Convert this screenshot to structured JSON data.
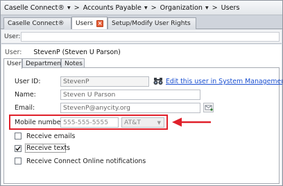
{
  "breadcrumb": {
    "items": [
      {
        "label": "Caselle Connect®",
        "dropdown": true
      },
      {
        "label": "Accounts Payable",
        "dropdown": true
      },
      {
        "label": "Organization",
        "dropdown": true
      },
      {
        "label": "Users",
        "dropdown": false
      }
    ],
    "separator": ">"
  },
  "tabs": [
    {
      "label": "Caselle Connect®",
      "active": false,
      "closable": false
    },
    {
      "label": "Users",
      "active": true,
      "closable": true
    },
    {
      "label": "Setup/Modify User Rights",
      "active": false,
      "closable": false
    }
  ],
  "search": {
    "label": "User:",
    "value": ""
  },
  "user_header": {
    "label": "User:",
    "value": "StevenP  (Steven U Parson)"
  },
  "inner_tabs": [
    {
      "label": "User",
      "active": true
    },
    {
      "label": "Departments",
      "active": false
    },
    {
      "label": "Notes",
      "active": false
    }
  ],
  "form": {
    "user_id": {
      "label": "User ID:",
      "value": "StevenP"
    },
    "edit_link": "Edit this user in System Management",
    "name": {
      "label": "Name:",
      "value": "Steven U Parson"
    },
    "email": {
      "label": "Email:",
      "value": "StevenP@anycity.org"
    },
    "mobile": {
      "label": "Mobile number:",
      "value": "555-555-5555",
      "carrier": "AT&T"
    },
    "checkboxes": [
      {
        "label": "Receive emails",
        "checked": false
      },
      {
        "label": "Receive texts",
        "checked": true
      },
      {
        "label": "Receive Connect Online notifications",
        "checked": false
      }
    ]
  },
  "icons": {
    "lookup": "binoculars-icon",
    "email": "email-icon",
    "close": "close-icon",
    "annotation": "red-arrow-icon"
  },
  "colors": {
    "annotation": "#e0202a",
    "link": "#1a4fd0",
    "tab_close": "#e8613a"
  }
}
